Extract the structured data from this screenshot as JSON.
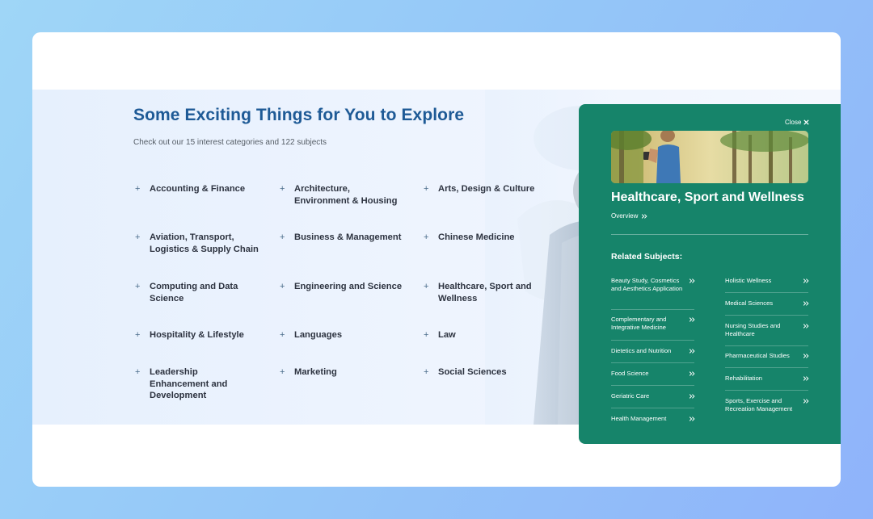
{
  "explore": {
    "title": "Some Exciting Things for You to Explore",
    "subtitle": "Check out our 15 interest categories and 122 subjects",
    "categories": [
      "Accounting & Finance",
      "Architecture, Environment & Housing",
      "Arts, Design & Culture",
      "Aviation, Transport, Logistics & Supply Chain",
      "Business & Management",
      "Chinese Medicine",
      "Computing and Data Science",
      "Engineering and Science",
      "Healthcare, Sport and Wellness",
      "Hospitality & Lifestyle",
      "Languages",
      "Law",
      "Leadership Enhancement and Development",
      "Marketing",
      "Social Sciences"
    ]
  },
  "panel": {
    "close_label": "Close",
    "title": "Healthcare, Sport and Wellness",
    "overview_label": "Overview",
    "related_heading": "Related Subjects:",
    "left_subjects": [
      "Beauty Study, Cosmetics and Aesthetics Application",
      "Complementary and Integrative Medicine",
      "Dietetics and Nutrition",
      "Food Science",
      "Geriatric Care",
      "Health Management"
    ],
    "right_subjects": [
      "Holistic Wellness",
      "Medical Sciences",
      "Nursing Studies and Healthcare",
      "Pharmaceutical Studies",
      "Rehabilitation",
      "Sports, Exercise and Recreation Management"
    ]
  },
  "colors": {
    "accent_title": "#1e5a96",
    "panel_green": "#16846a",
    "text_dark": "#2d3340"
  },
  "icons": {
    "category_bullet": "plus-icon",
    "subject_link": "double-chevron-right-icon",
    "close": "close-icon"
  }
}
